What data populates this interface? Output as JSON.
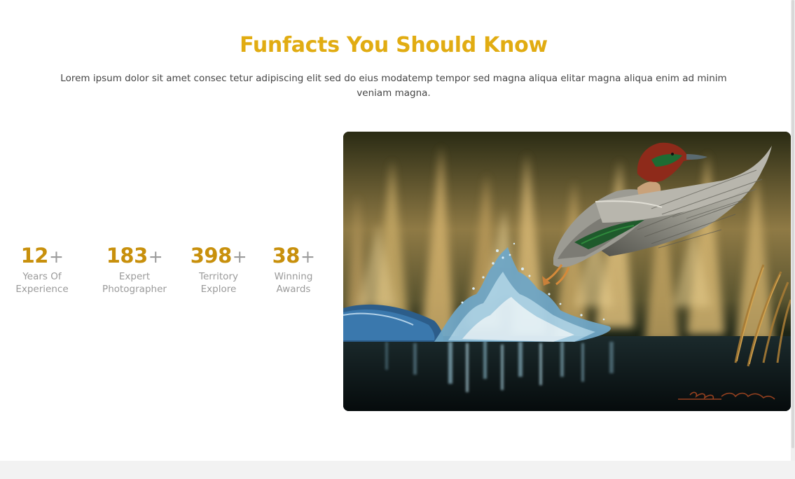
{
  "funfacts": {
    "title": "Funfacts You Should Know",
    "description": "Lorem ipsum dolor sit amet consec tetur adipiscing elit sed do eius modatemp tempor sed magna aliqua elitar magna aliqua enim ad minim veniam magna.",
    "stats": [
      {
        "value": "12",
        "suffix": "+",
        "line1": "Years Of",
        "line2": "Experience"
      },
      {
        "value": "183",
        "suffix": "+",
        "line1": "Expert",
        "line2": "Photographer"
      },
      {
        "value": "398",
        "suffix": "+",
        "line1": "Territory",
        "line2": "Explore"
      },
      {
        "value": "38",
        "suffix": "+",
        "line1": "Winning",
        "line2": "Awards"
      }
    ],
    "image": {
      "subject": "painting of a green-winged teal duck taking off from water among reeds",
      "signature": "D. Nicholson Miller"
    }
  },
  "colors": {
    "accent_title": "#e1ac12",
    "accent_number": "#c8900c",
    "muted_text": "#9a9a9a",
    "body_text": "#454545"
  }
}
